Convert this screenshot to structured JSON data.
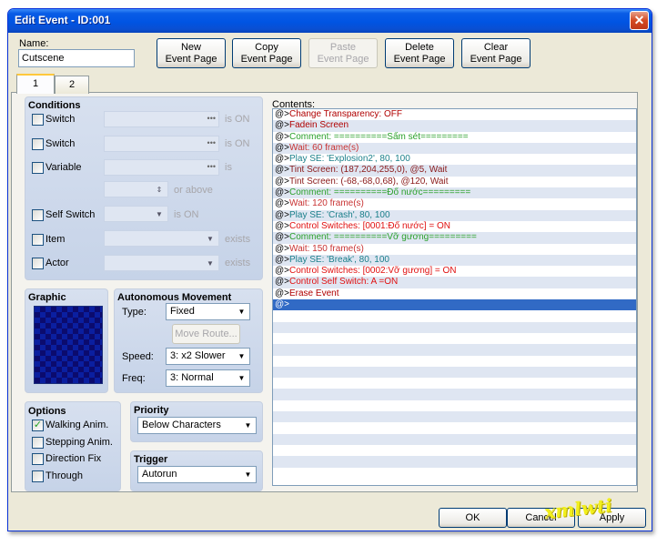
{
  "window": {
    "title": "Edit Event - ID:001",
    "close_glyph": "✕"
  },
  "name": {
    "label": "Name:",
    "value": "Cutscene"
  },
  "toolbar": {
    "new_line1": "New",
    "new_line2": "Event Page",
    "copy_line1": "Copy",
    "copy_line2": "Event Page",
    "paste_line1": "Paste",
    "paste_line2": "Event Page",
    "delete_line1": "Delete",
    "delete_line2": "Event Page",
    "clear_line1": "Clear",
    "clear_line2": "Event Page"
  },
  "tabs": [
    "1",
    "2"
  ],
  "conditions": {
    "title": "Conditions",
    "switch1": {
      "label": "Switch",
      "suffix": "is ON"
    },
    "switch2": {
      "label": "Switch",
      "suffix": "is ON"
    },
    "variable": {
      "label": "Variable",
      "suffix": "is",
      "or_above": "or above"
    },
    "self_switch": {
      "label": "Self Switch",
      "suffix": "is ON"
    },
    "item": {
      "label": "Item",
      "suffix": "exists"
    },
    "actor": {
      "label": "Actor",
      "suffix": "exists"
    }
  },
  "graphic": {
    "title": "Graphic"
  },
  "autonomous": {
    "title": "Autonomous Movement",
    "type_label": "Type:",
    "type_value": "Fixed",
    "move_route": "Move Route...",
    "speed_label": "Speed:",
    "speed_value": "3: x2 Slower",
    "freq_label": "Freq:",
    "freq_value": "3: Normal"
  },
  "options": {
    "title": "Options",
    "items": [
      {
        "label": "Walking Anim.",
        "checked": true
      },
      {
        "label": "Stepping Anim.",
        "checked": false
      },
      {
        "label": "Direction Fix",
        "checked": false
      },
      {
        "label": "Through",
        "checked": false
      }
    ]
  },
  "priority": {
    "title": "Priority",
    "value": "Below Characters"
  },
  "trigger": {
    "title": "Trigger",
    "value": "Autorun"
  },
  "contents": {
    "label": "Contents:",
    "prefix": "@>",
    "lines": [
      {
        "text": "Change Transparency: OFF",
        "color": "#b00000"
      },
      {
        "text": "Fadein Screen",
        "color": "#b00000"
      },
      {
        "text": "Comment: ==========Sấm sét=========",
        "color": "#2aa02a"
      },
      {
        "text": "Wait: 60 frame(s)",
        "color": "#c83232"
      },
      {
        "text": "Play SE: 'Explosion2', 80, 100",
        "color": "#1a7f8a"
      },
      {
        "text": "Tint Screen: (187,204,255,0), @5, Wait",
        "color": "#8a1a1a"
      },
      {
        "text": "Tint Screen: (-68,-68,0,68), @120, Wait",
        "color": "#8a1a1a"
      },
      {
        "text": "Comment: ==========Đổ nước=========",
        "color": "#2aa02a"
      },
      {
        "text": "Wait: 120 frame(s)",
        "color": "#c83232"
      },
      {
        "text": "Play SE: 'Crash', 80, 100",
        "color": "#1a7f8a"
      },
      {
        "text": "Control Switches: [0001:Đổ nước] = ON",
        "color": "#e01010"
      },
      {
        "text": "Comment: ==========Vỡ gương=========",
        "color": "#2aa02a"
      },
      {
        "text": "Wait: 150 frame(s)",
        "color": "#c83232"
      },
      {
        "text": "Play SE: 'Break', 80, 100",
        "color": "#1a7f8a"
      },
      {
        "text": "Control Switches: [0002:Vỡ gương] = ON",
        "color": "#e01010"
      },
      {
        "text": "Control Self Switch: A =ON",
        "color": "#e01010"
      },
      {
        "text": "Erase Event",
        "color": "#b00000"
      },
      {
        "text": "",
        "color": "#ffffff",
        "selected": true
      }
    ],
    "blank_rows": 15
  },
  "footer": {
    "ok": "OK",
    "cancel": "Cancel",
    "apply": "Apply"
  },
  "watermark": "xmlwti"
}
